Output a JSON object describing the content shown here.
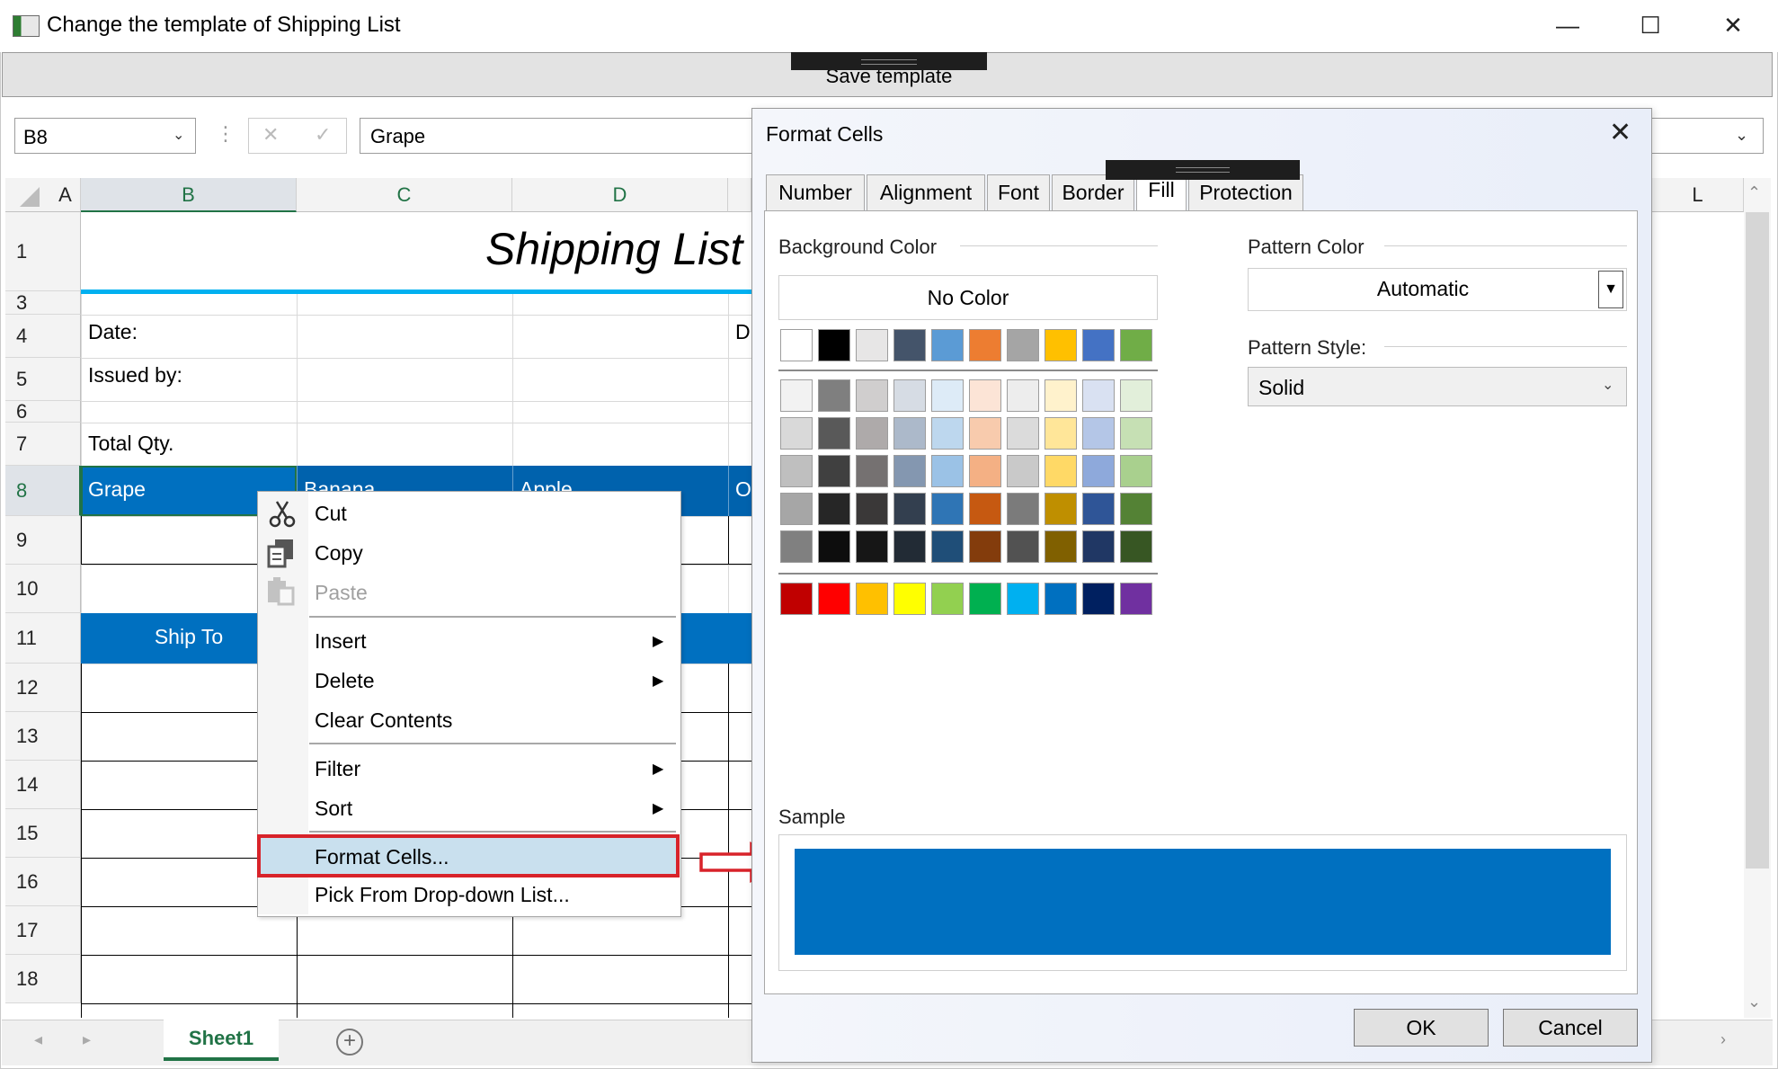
{
  "window": {
    "title": "Change the template of Shipping List",
    "minimize_glyph": "—",
    "maximize_glyph": "☐",
    "close_glyph": "✕"
  },
  "toolbar": {
    "save_label": "Save template"
  },
  "formula_bar": {
    "name_box": "B8",
    "value": "Grape",
    "cancel_glyph": "✕",
    "confirm_glyph": "✓"
  },
  "grid": {
    "columns": [
      "A",
      "B",
      "C",
      "D",
      "L"
    ],
    "rows": [
      "1",
      "3",
      "4",
      "5",
      "6",
      "7",
      "8",
      "9",
      "10",
      "11",
      "12",
      "13",
      "14",
      "15",
      "16",
      "17",
      "18"
    ],
    "cells": {
      "title": "Shipping List",
      "date_label": "Date:",
      "d4_partial": "D",
      "issued_by_label": "Issued by:",
      "total_qty_label": "Total Qty.",
      "b8": "Grape",
      "c8": "Banana",
      "d8": "Apple",
      "e8": "O",
      "ship_to": "Ship To"
    },
    "header_fill_color": "#0070c0",
    "selected_cell_fill_color": "#0062ad"
  },
  "sheet_tabs": {
    "active": "Sheet1",
    "add_glyph": "+"
  },
  "context_menu": {
    "items": [
      {
        "label": "Cut",
        "icon": "scissors-icon",
        "enabled": true
      },
      {
        "label": "Copy",
        "icon": "copy-icon",
        "enabled": true
      },
      {
        "label": "Paste",
        "icon": "paste-icon",
        "enabled": false
      },
      {
        "label": "Insert",
        "submenu": true
      },
      {
        "label": "Delete",
        "submenu": true
      },
      {
        "label": "Clear Contents"
      },
      {
        "label": "Filter",
        "submenu": true
      },
      {
        "label": "Sort",
        "submenu": true
      },
      {
        "label": "Format Cells...",
        "highlighted": true
      },
      {
        "label": "Pick From Drop-down List..."
      }
    ]
  },
  "dialog": {
    "title": "Format Cells",
    "close_glyph": "✕",
    "tabs": [
      "Number",
      "Alignment",
      "Font",
      "Border",
      "Fill",
      "Protection"
    ],
    "active_tab": "Fill",
    "background_color_label": "Background Color",
    "no_color_label": "No Color",
    "pattern_color_label": "Pattern Color",
    "pattern_color_value": "Automatic",
    "pattern_style_label": "Pattern Style:",
    "pattern_style_value": "Solid",
    "sample_label": "Sample",
    "sample_color": "#0070c0",
    "ok_label": "OK",
    "cancel_label": "Cancel",
    "theme_row": [
      "#ffffff",
      "#000000",
      "#e7e6e6",
      "#44546a",
      "#5b9bd5",
      "#ed7d31",
      "#a5a5a5",
      "#ffc000",
      "#4472c4",
      "#70ad47"
    ],
    "tint_rows": [
      [
        "#f2f2f2",
        "#7f7f7f",
        "#d0cece",
        "#d6dce4",
        "#ddebf7",
        "#fce4d6",
        "#ededed",
        "#fff2cc",
        "#d9e1f2",
        "#e2efda"
      ],
      [
        "#d9d9d9",
        "#595959",
        "#aeaaaa",
        "#acb9ca",
        "#bdd7ee",
        "#f8cbad",
        "#dbdbdb",
        "#ffe699",
        "#b4c6e7",
        "#c6e0b4"
      ],
      [
        "#bfbfbf",
        "#404040",
        "#757171",
        "#8497b0",
        "#9bc2e6",
        "#f4b084",
        "#c9c9c9",
        "#ffd966",
        "#8ea9db",
        "#a9d08e"
      ],
      [
        "#a6a6a6",
        "#262626",
        "#3a3838",
        "#333f4f",
        "#2f75b5",
        "#c65911",
        "#7b7b7b",
        "#bf8f00",
        "#2f5597",
        "#548235"
      ],
      [
        "#808080",
        "#0d0d0d",
        "#161616",
        "#222b35",
        "#1f4e78",
        "#833c0c",
        "#525252",
        "#806000",
        "#203764",
        "#375623"
      ]
    ],
    "standard_row": [
      "#c00000",
      "#ff0000",
      "#ffc000",
      "#ffff00",
      "#92d050",
      "#00b050",
      "#00b0f0",
      "#0070c0",
      "#002060",
      "#7030a0"
    ]
  }
}
